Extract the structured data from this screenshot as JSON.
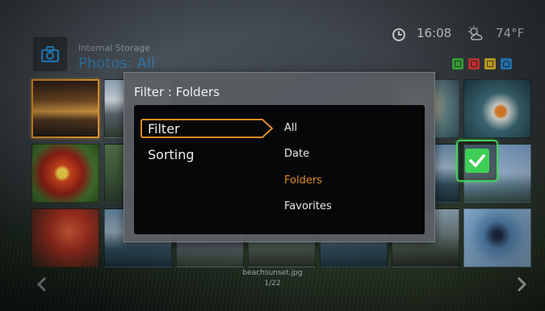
{
  "header": {
    "storage": "Internal Storage",
    "section": "Photos: All",
    "camera_icon": "camera-icon",
    "time": "16:08",
    "temperature": "74°F",
    "clock_icon": "clock-icon",
    "weather_icon": "partly-cloudy-icon",
    "color_buttons": [
      {
        "name": "green",
        "color": "#3fae3f"
      },
      {
        "name": "red",
        "color": "#d83a3a"
      },
      {
        "name": "yellow",
        "color": "#e0b92a"
      },
      {
        "name": "blue",
        "color": "#2f8fd6"
      }
    ]
  },
  "dialog": {
    "title": "Filter : Folders",
    "categories": [
      {
        "label": "Filter",
        "focused": true
      },
      {
        "label": "Sorting",
        "focused": false
      }
    ],
    "options": [
      {
        "label": "All",
        "active": false
      },
      {
        "label": "Date",
        "active": false
      },
      {
        "label": "Folders",
        "active": true
      },
      {
        "label": "Favorites",
        "active": false
      }
    ],
    "accent_color": "#e08a2a"
  },
  "confirm": {
    "icon": "checkmark-icon",
    "color": "#3fcf57"
  },
  "footer": {
    "filename": "beachsunset.jpg",
    "counter": "1/22"
  }
}
